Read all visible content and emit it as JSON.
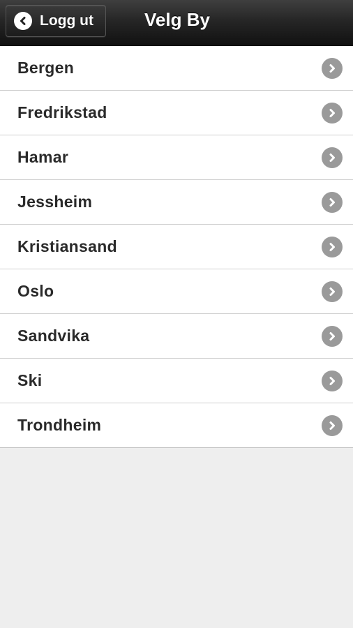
{
  "header": {
    "back_label": "Logg ut",
    "title": "Velg By",
    "back_icon": "chevron-left-icon"
  },
  "cities": [
    {
      "label": "Bergen"
    },
    {
      "label": "Fredrikstad"
    },
    {
      "label": "Hamar"
    },
    {
      "label": "Jessheim"
    },
    {
      "label": "Kristiansand"
    },
    {
      "label": "Oslo"
    },
    {
      "label": "Sandvika"
    },
    {
      "label": "Ski"
    },
    {
      "label": "Trondheim"
    }
  ],
  "colors": {
    "header_bg": "#1a1a1a",
    "list_bg": "#ffffff",
    "page_bg": "#eeeeee",
    "chevron": "#9a9a9a",
    "text": "#2a2a2a"
  }
}
